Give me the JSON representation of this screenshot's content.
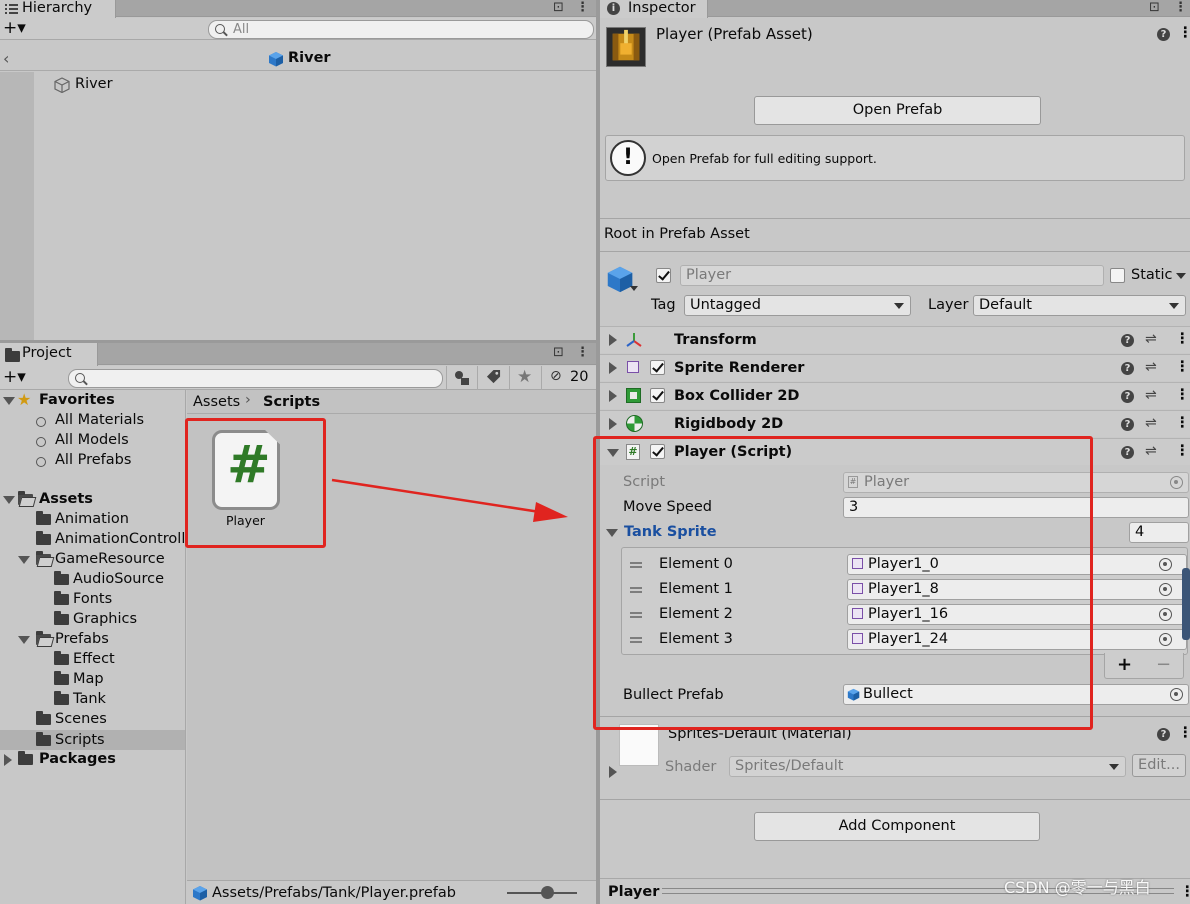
{
  "hierarchy": {
    "tab_label": "Hierarchy",
    "add_label": "+▾",
    "search_placeholder": "All",
    "scene_title": "River",
    "items": [
      "River"
    ]
  },
  "project": {
    "tab_label": "Project",
    "add_label": "+▾",
    "hidden_count": "20",
    "breadcrumb": {
      "root": "Assets",
      "current": "Scripts"
    },
    "tree": {
      "favorites": {
        "label": "Favorites",
        "items": [
          "All Materials",
          "All Models",
          "All Prefabs"
        ]
      },
      "assets": {
        "label": "Assets",
        "folders": {
          "animation": "Animation",
          "animation_controller": "AnimationControll",
          "game_resource": "GameResource",
          "audio_source": "AudioSource",
          "fonts": "Fonts",
          "graphics": "Graphics",
          "prefabs": "Prefabs",
          "effect": "Effect",
          "map": "Map",
          "tank": "Tank",
          "scenes": "Scenes",
          "scripts": "Scripts"
        }
      },
      "packages": "Packages"
    },
    "grid_items": [
      {
        "label": "Player",
        "icon_glyph": "#"
      }
    ],
    "status_path": "Assets/Prefabs/Tank/Player.prefab"
  },
  "inspector": {
    "tab_label": "Inspector",
    "asset_title": "Player (Prefab Asset)",
    "open_prefab_label": "Open Prefab",
    "help_message": "Open Prefab for full editing support.",
    "root_label": "Root in Prefab Asset",
    "gameobject": {
      "name": "Player",
      "static_label": "Static",
      "tag_label": "Tag",
      "tag_value": "Untagged",
      "layer_label": "Layer",
      "layer_value": "Default"
    },
    "components": {
      "transform": "Transform",
      "sprite_renderer": "Sprite Renderer",
      "box_collider": "Box Collider 2D",
      "rigidbody": "Rigidbody 2D",
      "player_script": "Player (Script)"
    },
    "script_fields": {
      "script_label": "Script",
      "script_value": "Player",
      "move_speed_label": "Move Speed",
      "move_speed_value": "3",
      "tank_sprite_label": "Tank Sprite",
      "tank_sprite_size": "4",
      "elements": [
        {
          "label": "Element 0",
          "value": "Player1_0"
        },
        {
          "label": "Element 1",
          "value": "Player1_8"
        },
        {
          "label": "Element 2",
          "value": "Player1_16"
        },
        {
          "label": "Element 3",
          "value": "Player1_24"
        }
      ],
      "add_label": "+",
      "remove_label": "−",
      "bullet_label": "Bullect Prefab",
      "bullet_value": "Bullect"
    },
    "material": {
      "title": "Sprites-Default (Material)",
      "shader_label": "Shader",
      "shader_value": "Sprites/Default",
      "edit_label": "Edit..."
    },
    "add_component_label": "Add Component",
    "footer_label": "Player"
  },
  "watermark": "CSDN @零一与黑白",
  "colors": {
    "annotation_red": "#e0241f",
    "link_blue": "#1a4fa0",
    "panel_gray": "#c8c8c8"
  }
}
